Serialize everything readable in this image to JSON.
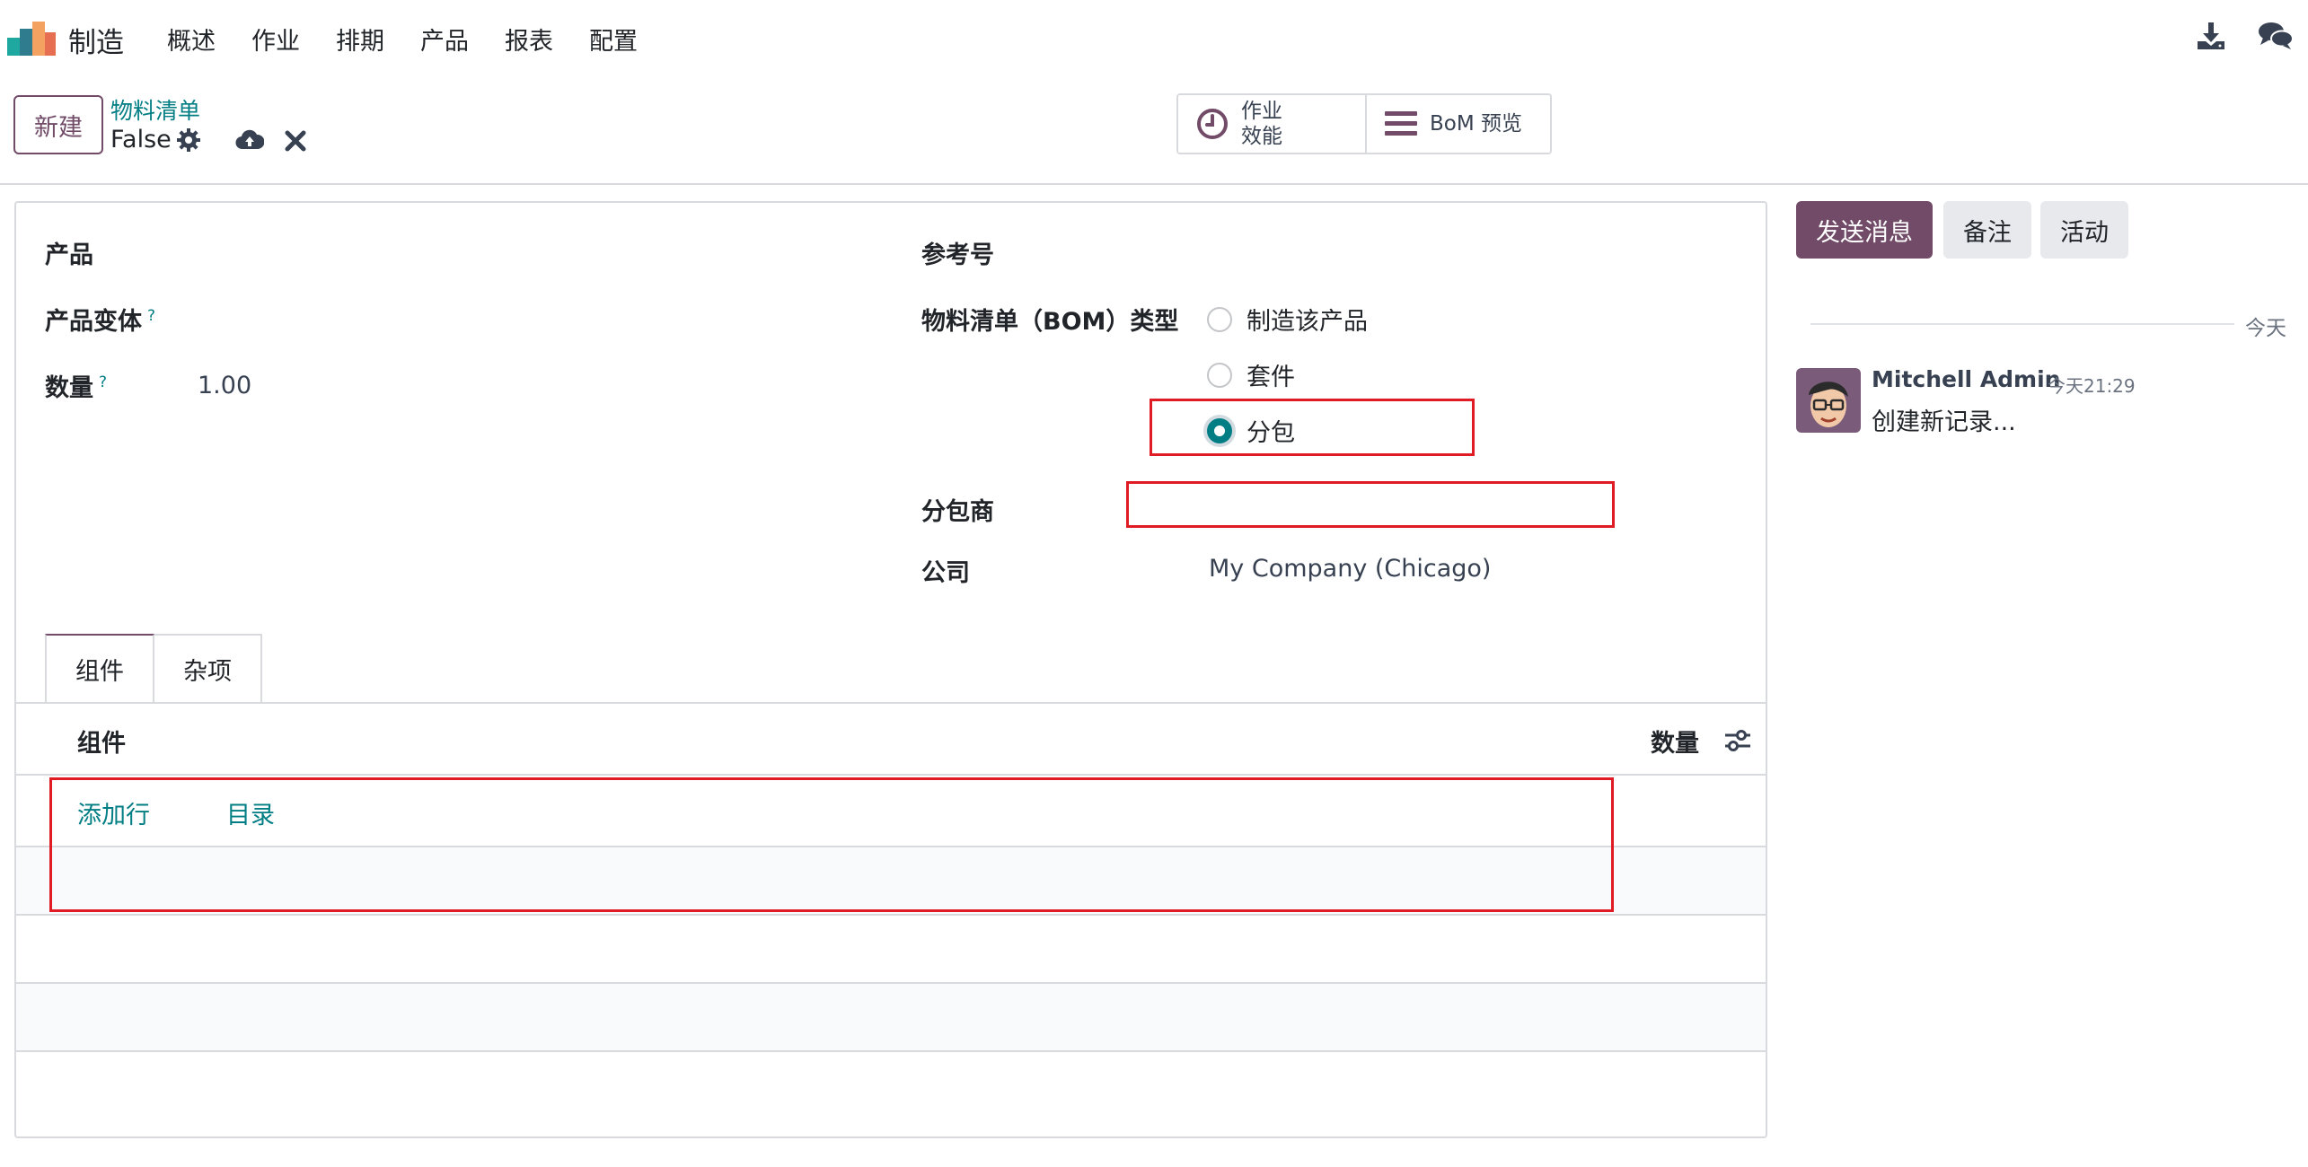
{
  "navbar": {
    "app_name": "制造",
    "menu": [
      "概述",
      "作业",
      "排期",
      "产品",
      "报表",
      "配置"
    ],
    "icons": [
      "download-icon",
      "chat-icon"
    ]
  },
  "control_panel": {
    "new_label": "新建",
    "breadcrumb": "物料清单",
    "record_name": "False",
    "stat_buttons": [
      {
        "icon": "clock-icon",
        "line1": "作业",
        "line2": "效能"
      },
      {
        "icon": "list-icon",
        "label": "BoM 预览"
      }
    ]
  },
  "form": {
    "left": {
      "product_label": "产品",
      "variant_label": "产品变体",
      "variant_help": "?",
      "qty_label": "数量",
      "qty_help": "?",
      "qty_value": "1.00"
    },
    "right": {
      "reference_label": "参考号",
      "bom_type_label": "物料清单（BOM）类型",
      "bom_type_options": [
        {
          "label": "制造该产品",
          "checked": false
        },
        {
          "label": "套件",
          "checked": false
        },
        {
          "label": "分包",
          "checked": true
        }
      ],
      "subcontractor_label": "分包商",
      "subcontractor_value": "",
      "company_label": "公司",
      "company_value": "My Company (Chicago)"
    },
    "tabs": [
      {
        "label": "组件",
        "active": true
      },
      {
        "label": "杂项",
        "active": false
      }
    ],
    "components": {
      "col_component": "组件",
      "col_quantity": "数量",
      "add_line": "添加行",
      "catalog": "目录"
    }
  },
  "chatter": {
    "send_message": "发送消息",
    "log_note": "备注",
    "activity": "活动",
    "date_separator": "今天",
    "messages": [
      {
        "author": "Mitchell Admin",
        "time": "今天21:29",
        "body": "创建新记录..."
      }
    ]
  },
  "colors": {
    "brand": "#714b67",
    "link": "#017e84",
    "highlight": "#e01b24"
  }
}
